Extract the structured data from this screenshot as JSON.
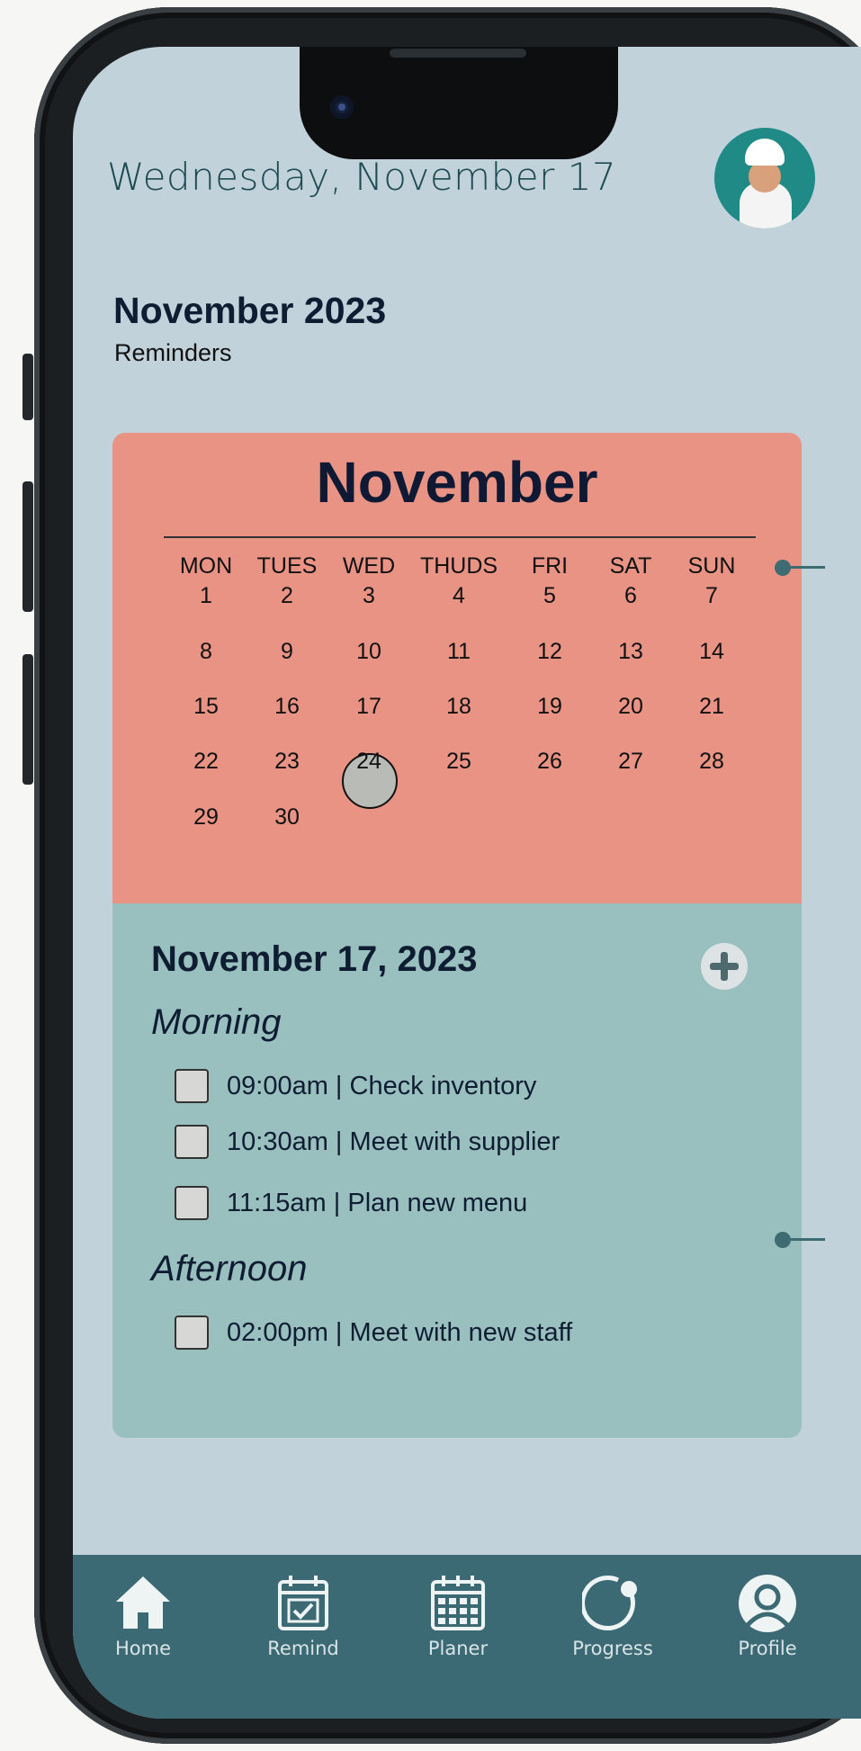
{
  "header": {
    "date": "Wednesday, November 17"
  },
  "summary": {
    "title": "November 2023",
    "subtitle": "Reminders"
  },
  "calendar": {
    "month": "November",
    "weekdays": [
      "MON",
      "TUES",
      "WED",
      "THUDS",
      "FRI",
      "SAT",
      "SUN"
    ],
    "days": [
      "1",
      "2",
      "3",
      "4",
      "5",
      "6",
      "7",
      "8",
      "9",
      "10",
      "11",
      "12",
      "13",
      "14",
      "15",
      "16",
      "17",
      "18",
      "19",
      "20",
      "21",
      "22",
      "23",
      "24",
      "25",
      "26",
      "27",
      "28",
      "29",
      "30"
    ],
    "selected_day": "17"
  },
  "agenda": {
    "date": "November 17, 2023",
    "morning_label": "Morning",
    "morning": [
      "09:00am | Check inventory",
      "10:30am | Meet with supplier",
      "11:15am | Plan new menu"
    ],
    "afternoon_label": "Afternoon",
    "afternoon": [
      "02:00pm | Meet with new staff"
    ]
  },
  "nav": {
    "items": [
      {
        "label": "Home",
        "icon": "home-icon"
      },
      {
        "label": "Remind",
        "icon": "calendar-check-icon"
      },
      {
        "label": "Planer",
        "icon": "calendar-grid-icon"
      },
      {
        "label": "Progress",
        "icon": "progress-icon"
      },
      {
        "label": "Profile",
        "icon": "profile-icon"
      }
    ]
  },
  "colors": {
    "screen_bg": "#c1d2da",
    "calendar_bg": "#e89384",
    "agenda_bg": "#99bfbf",
    "nav_bg": "#3b6a74",
    "heading": "#0f1d33"
  }
}
